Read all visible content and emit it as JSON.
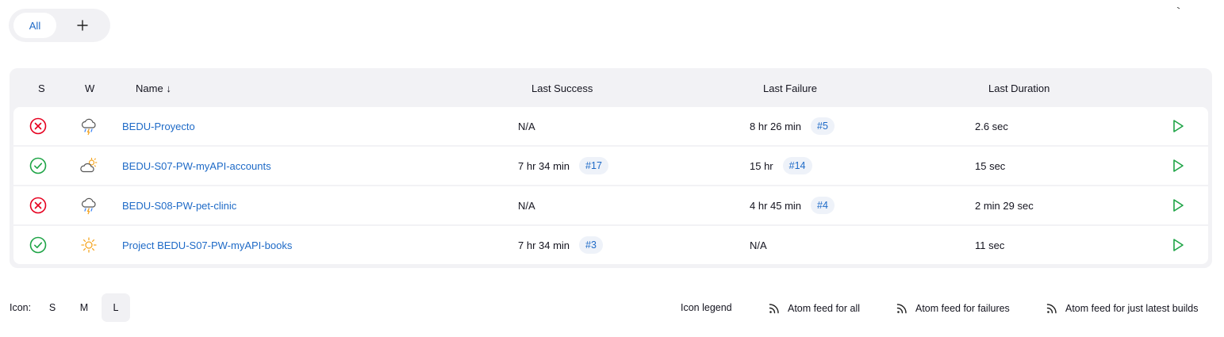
{
  "views": {
    "tabs": [
      {
        "label": "All",
        "active": true
      }
    ],
    "add_icon": "plus-icon"
  },
  "table": {
    "headers": {
      "status": "S",
      "weather": "W",
      "name": "Name",
      "sort_indicator": "↓",
      "last_success": "Last Success",
      "last_failure": "Last Failure",
      "last_duration": "Last Duration"
    },
    "rows": [
      {
        "status": "failed",
        "status_icon": "failed-icon",
        "weather": "thunderstorm",
        "weather_icon": "thunderstorm-icon",
        "name": "BEDU-Proyecto",
        "last_success": "N/A",
        "last_success_build": "",
        "last_failure": "8 hr 26 min",
        "last_failure_build": "#5",
        "last_duration": "2.6 sec"
      },
      {
        "status": "success",
        "status_icon": "success-icon",
        "weather": "partly-cloudy",
        "weather_icon": "partly-cloudy-icon",
        "name": "BEDU-S07-PW-myAPI-accounts",
        "last_success": "7 hr 34 min",
        "last_success_build": "#17",
        "last_failure": "15 hr",
        "last_failure_build": "#14",
        "last_duration": "15 sec"
      },
      {
        "status": "failed",
        "status_icon": "failed-icon",
        "weather": "thunderstorm",
        "weather_icon": "thunderstorm-icon",
        "name": "BEDU-S08-PW-pet-clinic",
        "last_success": "N/A",
        "last_success_build": "",
        "last_failure": "4 hr 45 min",
        "last_failure_build": "#4",
        "last_duration": "2 min 29 sec"
      },
      {
        "status": "success",
        "status_icon": "success-icon",
        "weather": "sunny",
        "weather_icon": "sunny-icon",
        "name": "Project BEDU-S07-PW-myAPI-books",
        "last_success": "7 hr 34 min",
        "last_success_build": "#3",
        "last_failure": "N/A",
        "last_failure_build": "",
        "last_duration": "11 sec"
      }
    ]
  },
  "footer": {
    "icon_label": "Icon:",
    "sizes": [
      {
        "label": "S",
        "active": false
      },
      {
        "label": "M",
        "active": false
      },
      {
        "label": "L",
        "active": true
      }
    ],
    "links": [
      "Icon legend",
      "Atom feed for all",
      "Atom feed for failures",
      "Atom feed for just latest builds"
    ]
  },
  "colors": {
    "link": "#1e6ac7",
    "success": "#1ea446",
    "failure": "#e6001f",
    "sunny": "#f5a623",
    "run": "#1ea446"
  }
}
